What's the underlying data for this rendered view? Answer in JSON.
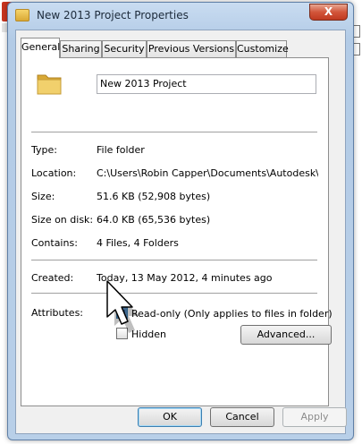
{
  "window": {
    "title": "New 2013 Project Properties",
    "close_label": "X"
  },
  "tabs": [
    {
      "label": "General",
      "active": true
    },
    {
      "label": "Sharing",
      "active": false
    },
    {
      "label": "Security",
      "active": false
    },
    {
      "label": "Previous Versions",
      "active": false
    },
    {
      "label": "Customize",
      "active": false
    }
  ],
  "general": {
    "name_value": "New 2013 Project",
    "type_label": "Type:",
    "type_value": "File folder",
    "location_label": "Location:",
    "location_value": "C:\\Users\\Robin Capper\\Documents\\Autodesk\\My P",
    "size_label": "Size:",
    "size_value": "51.6 KB (52,908 bytes)",
    "size_on_disk_label": "Size on disk:",
    "size_on_disk_value": "64.0 KB (65,536 bytes)",
    "contains_label": "Contains:",
    "contains_value": "4 Files, 4 Folders",
    "created_label": "Created:",
    "created_value": "Today, 13 May 2012, 4 minutes ago",
    "attributes_label": "Attributes:",
    "readonly_label": "Read-only (Only applies to files in folder)",
    "hidden_label": "Hidden",
    "advanced_label": "Advanced..."
  },
  "footer": {
    "ok_label": "OK",
    "cancel_label": "Cancel",
    "apply_label": "Apply"
  },
  "colors": {
    "accent": "#3c7fb1",
    "close_button": "#c03a20",
    "folder": "#e8c25a"
  }
}
